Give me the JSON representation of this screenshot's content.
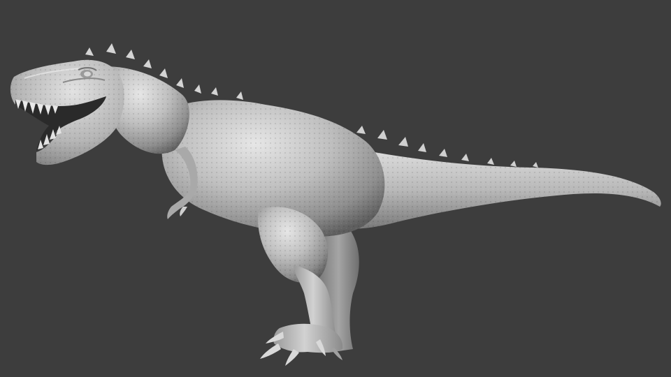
{
  "viewport": {
    "background_color": "#3d3d3d",
    "subject": "t-rex-sculpt",
    "material_color": "#bdbdbd"
  }
}
